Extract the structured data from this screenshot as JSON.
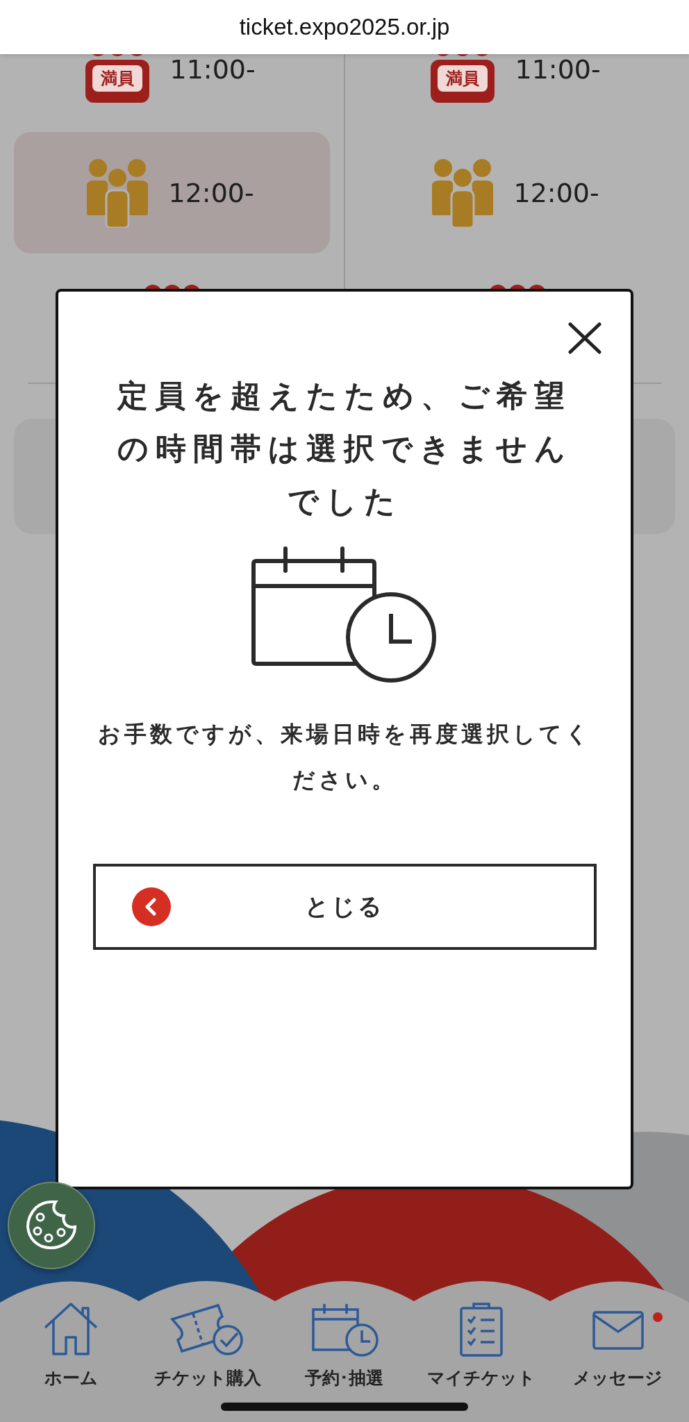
{
  "browser": {
    "url": "ticket.expo2025.or.jp"
  },
  "slot_columns": [
    {
      "slots": [
        {
          "kind": "full",
          "badge": "満員",
          "time": "11:00-",
          "selected": false
        },
        {
          "kind": "available",
          "time": "12:00-",
          "selected": true
        },
        {
          "kind": "full"
        }
      ]
    },
    {
      "slots": [
        {
          "kind": "full",
          "badge": "満員",
          "time": "11:00-",
          "selected": false
        },
        {
          "kind": "available",
          "time": "12:00-",
          "selected": false
        },
        {
          "kind": "full"
        }
      ]
    }
  ],
  "modal": {
    "title": "定員を超えたため、ご希望の時間帯は選択できませんでした",
    "message": "お手数ですが、来場日時を再度選択してください。",
    "button": "とじる"
  },
  "bottom_nav": [
    {
      "label": "ホーム",
      "notification": false
    },
    {
      "label": "チケット購入",
      "notification": false
    },
    {
      "label": "予約･抽選",
      "notification": false
    },
    {
      "label": "マイチケット",
      "notification": false
    },
    {
      "label": "メッセージ",
      "notification": true
    }
  ]
}
